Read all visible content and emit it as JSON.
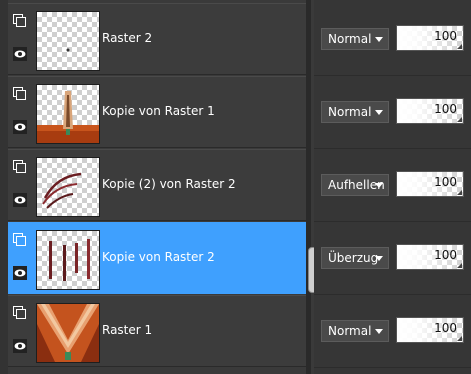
{
  "layers": [
    {
      "name": "Raster 2",
      "blend_mode": "Normal",
      "opacity": "100",
      "selected": false,
      "visible_icon": "eye-icon",
      "link_icon": "layer-group-icon"
    },
    {
      "name": "Kopie von Raster 1",
      "blend_mode": "Normal",
      "opacity": "100",
      "selected": false,
      "visible_icon": "eye-icon",
      "link_icon": "layer-group-icon"
    },
    {
      "name": "Kopie (2) von Raster 2",
      "blend_mode": "Aufhellen",
      "opacity": "100",
      "selected": false,
      "visible_icon": "eye-icon",
      "link_icon": "layer-group-icon"
    },
    {
      "name": "Kopie von Raster 2",
      "blend_mode": "Überzug",
      "opacity": "100",
      "selected": true,
      "visible_icon": "eye-icon",
      "link_icon": "layer-group-icon"
    },
    {
      "name": "Raster 1",
      "blend_mode": "Normal",
      "opacity": "100",
      "selected": false,
      "visible_icon": "eye-icon",
      "link_icon": "layer-group-icon"
    }
  ],
  "colors": {
    "selected": "#3fa0fe",
    "panel": "#3a3a3a"
  }
}
